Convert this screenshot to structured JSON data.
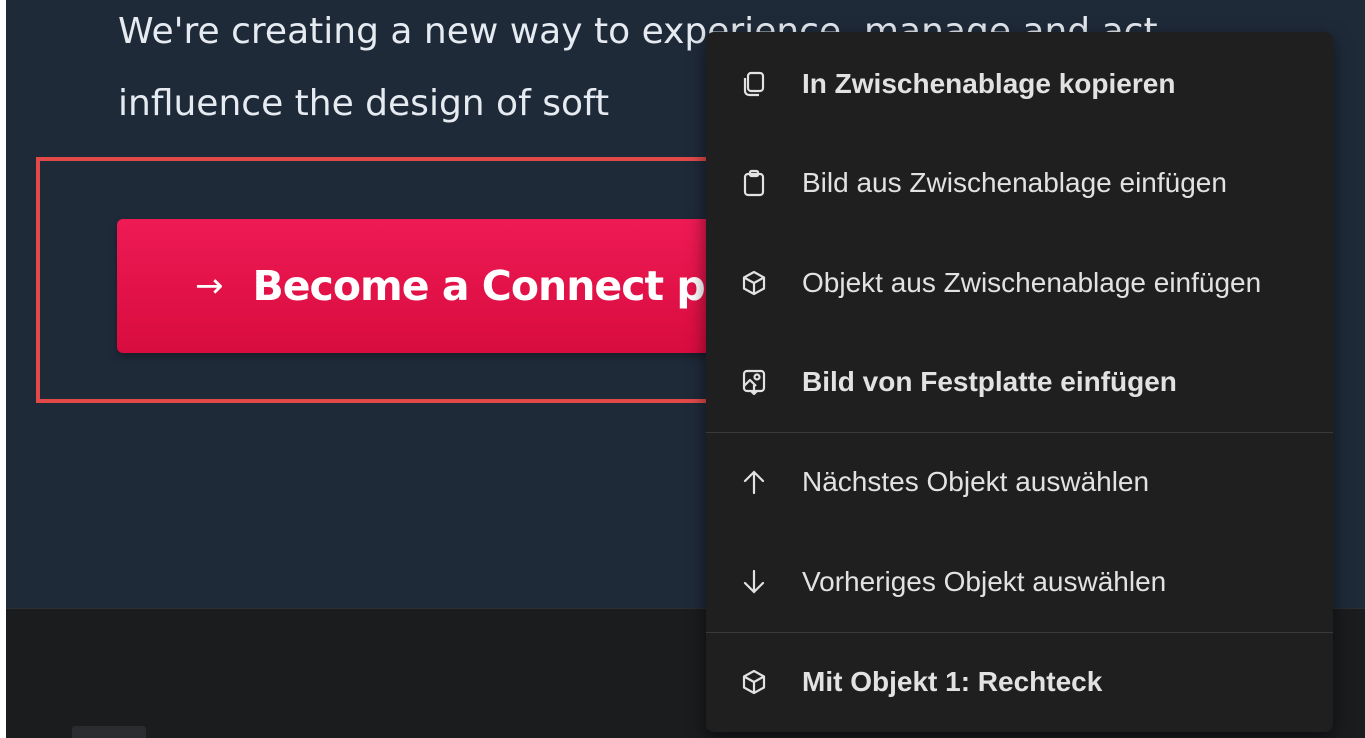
{
  "page": {
    "hero_line_1": "We're creating a new way to experience, manage and act",
    "hero_line_2": "influence the design of soft",
    "cta_label": "Become a Connect pio",
    "cta_arrow": "→"
  },
  "context_menu": {
    "items": [
      {
        "label": "In Zwischenablage kopieren",
        "icon": "copy-icon"
      },
      {
        "label": "Bild aus Zwischenablage einfügen",
        "icon": "clipboard-icon"
      },
      {
        "label": "Objekt aus Zwischenablage einfügen",
        "icon": "cube-icon"
      },
      {
        "label": "Bild von Festplatte einfügen",
        "icon": "image-upload-icon"
      },
      {
        "label": "Nächstes Objekt auswählen",
        "icon": "arrow-up-icon"
      },
      {
        "label": "Vorheriges Objekt auswählen",
        "icon": "arrow-down-icon"
      },
      {
        "label": "Mit Objekt 1: Rechteck",
        "icon": "cube-icon"
      }
    ]
  },
  "colors": {
    "hero_bg": "#1f2a39",
    "cta_bg": "#e8134a",
    "selection_frame": "#e24a4a",
    "menu_bg": "#1f1f20"
  }
}
